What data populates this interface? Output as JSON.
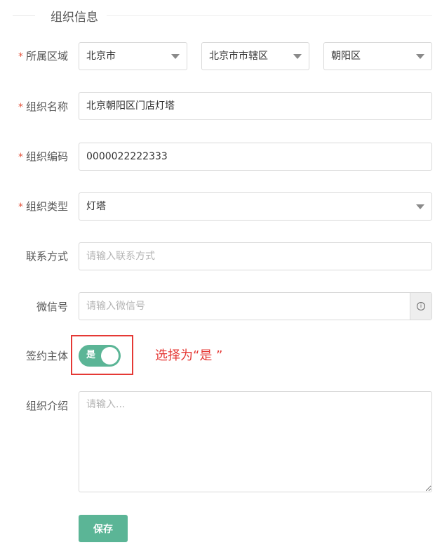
{
  "section": {
    "title": "组织信息"
  },
  "fields": {
    "region": {
      "label": "所属区域",
      "required_mark": "*",
      "city": "北京市",
      "district_group": "北京市市辖区",
      "district": "朝阳区"
    },
    "org_name": {
      "label": "组织名称",
      "required_mark": "*",
      "value": "北京朝阳区门店灯塔"
    },
    "org_code": {
      "label": "组织编码",
      "required_mark": "*",
      "value": "0000022222333"
    },
    "org_type": {
      "label": "组织类型",
      "required_mark": "*",
      "value": "灯塔"
    },
    "contact": {
      "label": "联系方式",
      "placeholder": "请输入联系方式"
    },
    "wechat": {
      "label": "微信号",
      "placeholder": "请输入微信号",
      "suffix_icon": "info-icon"
    },
    "signing": {
      "label": "签约主体",
      "toggle_text": "是",
      "toggle_on": true
    },
    "intro": {
      "label": "组织介绍",
      "placeholder": "请输入..."
    }
  },
  "annotation": "选择为“是 ”",
  "save_label": "保存",
  "colors": {
    "accent": "#5bb596",
    "required": "#e4563f",
    "highlight": "#e53935"
  }
}
